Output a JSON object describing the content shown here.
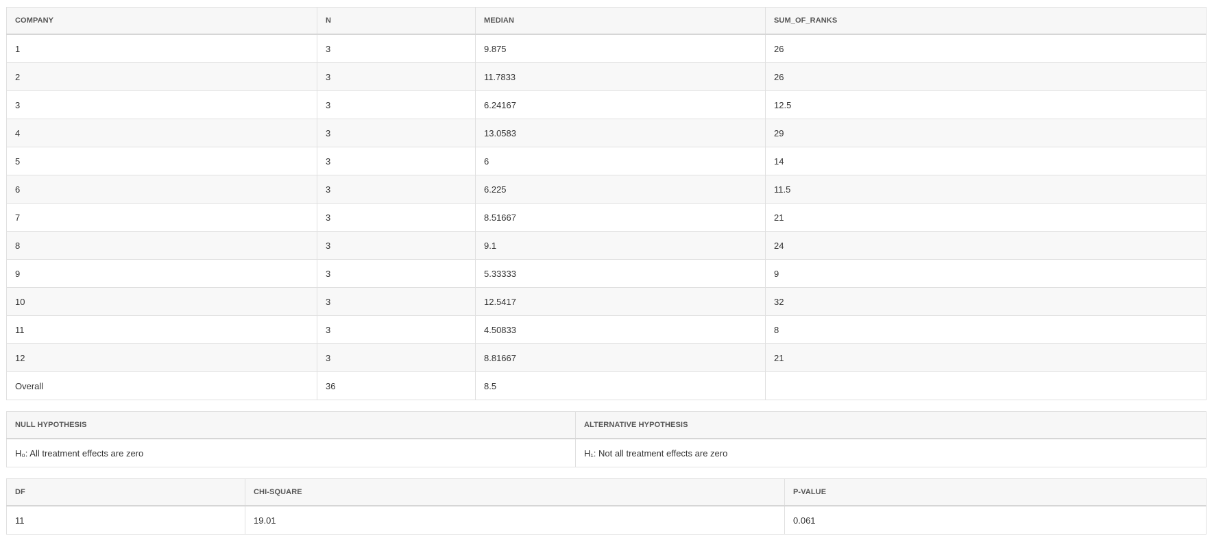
{
  "stats_table": {
    "columns": [
      "COMPANY",
      "N",
      "MEDIAN",
      "SUM_OF_RANKS"
    ],
    "rows": [
      [
        "1",
        "3",
        "9.875",
        "26"
      ],
      [
        "2",
        "3",
        "11.7833",
        "26"
      ],
      [
        "3",
        "3",
        "6.24167",
        "12.5"
      ],
      [
        "4",
        "3",
        "13.0583",
        "29"
      ],
      [
        "5",
        "3",
        "6",
        "14"
      ],
      [
        "6",
        "3",
        "6.225",
        "11.5"
      ],
      [
        "7",
        "3",
        "8.51667",
        "21"
      ],
      [
        "8",
        "3",
        "9.1",
        "24"
      ],
      [
        "9",
        "3",
        "5.33333",
        "9"
      ],
      [
        "10",
        "3",
        "12.5417",
        "32"
      ],
      [
        "11",
        "3",
        "4.50833",
        "8"
      ],
      [
        "12",
        "3",
        "8.81667",
        "21"
      ],
      [
        "Overall",
        "36",
        "8.5",
        ""
      ]
    ]
  },
  "hypothesis_table": {
    "columns": [
      "NULL HYPOTHESIS",
      "ALTERNATIVE HYPOTHESIS"
    ],
    "rows": [
      [
        "H₀: All treatment effects are zero",
        "H₁: Not all treatment effects are zero"
      ]
    ]
  },
  "test_table": {
    "columns": [
      "DF",
      "CHI-SQUARE",
      "P-VALUE"
    ],
    "rows": [
      [
        "11",
        "19.01",
        "0.061"
      ]
    ]
  }
}
